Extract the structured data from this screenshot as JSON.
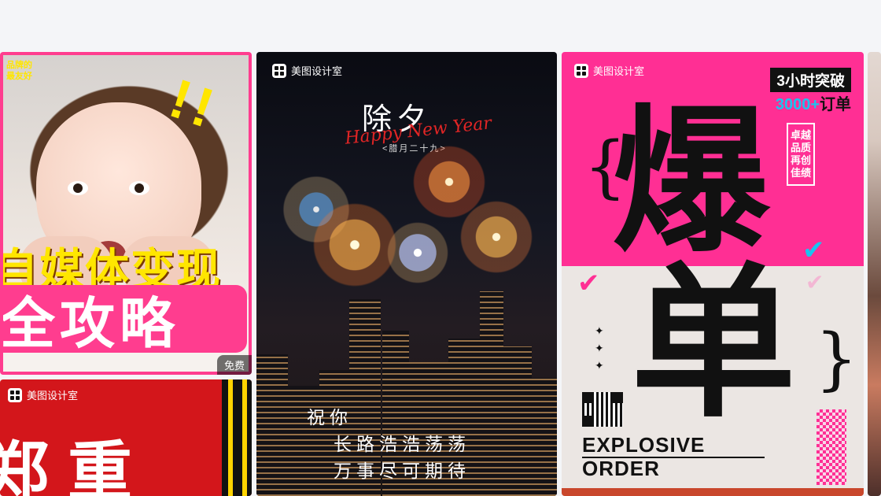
{
  "cards": {
    "card1": {
      "tagline": [
        "品牌的",
        "最友好"
      ],
      "headline_line1": "自媒体变现",
      "headline_line2": "全攻略",
      "badge": "免费",
      "colors": {
        "pink": "#ff3d8f",
        "yellow": "#ffe600"
      }
    },
    "card2": {
      "brand": "美图设计室",
      "headline": "郑重"
    },
    "card3": {
      "brand": "美图设计室",
      "title_cn": "除夕",
      "title_en": "Happy New Year",
      "date": "<腊月二十九>",
      "blessing": [
        "祝你",
        "长路浩浩荡荡",
        "万事尽可期待"
      ]
    },
    "card4": {
      "brand": "美图设计室",
      "badge_top": "3小时突破",
      "badge_count": "3000+",
      "badge_count_suffix": "订单",
      "big_char_1": "爆",
      "big_char_2": "单",
      "vertical_text": "卓越品质 再创佳绩",
      "en_line1": "EXPLOSIVE",
      "en_line2": "ORDER",
      "colors": {
        "pink": "#ff2f94",
        "cyan": "#19c4f0"
      }
    }
  }
}
